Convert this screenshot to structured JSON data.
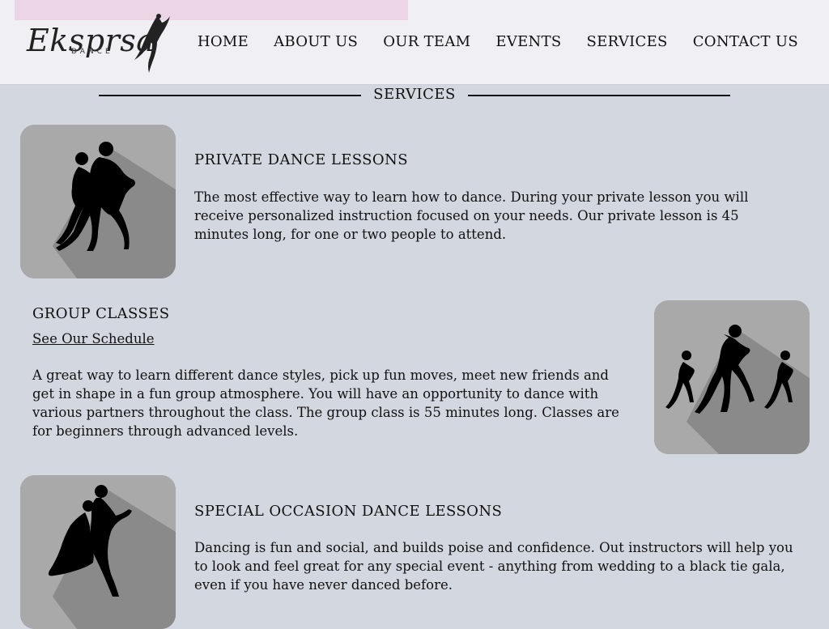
{
  "brand": {
    "name": "Eksprsa",
    "sub": "DANCE"
  },
  "nav": [
    "HOME",
    "ABOUT US",
    "OUR TEAM",
    "EVENTS",
    "SERVICES",
    "CONTACT US"
  ],
  "section": {
    "title": "SERVICES"
  },
  "services": [
    {
      "title": "PRIVATE DANCE LESSONS",
      "description": "The most effective way to learn how to dance. During your private lesson you will receive personalized instruction focused on your needs. Our private lesson is 45 minutes long, for one or two people to attend.",
      "icon": "tango-couple-icon"
    },
    {
      "title": "GROUP CLASSES",
      "link": "See Our Schedule",
      "description": "A great way to learn different dance styles, pick up fun moves, meet new friends and get in shape in a fun group atmosphere. You will have an opportunity to dance with various partners throughout the class. The group class is 55 minutes long. Classes are for beginners through advanced levels.",
      "icon": "group-dancers-icon"
    },
    {
      "title": "SPECIAL OCCASION DANCE LESSONS",
      "description": "Dancing is fun and social, and builds poise and confidence. Out instructors will help you to look and feel great for any special event - anything from wedding to a black tie gala, even if you have never danced before.",
      "icon": "ballroom-couple-icon"
    }
  ],
  "colors": {
    "page_bg": "#d3d7e0",
    "header_bg": "#f0f0f4",
    "tile_light": "#a9a9a9",
    "tile_shadow": "#8a8a8a"
  }
}
